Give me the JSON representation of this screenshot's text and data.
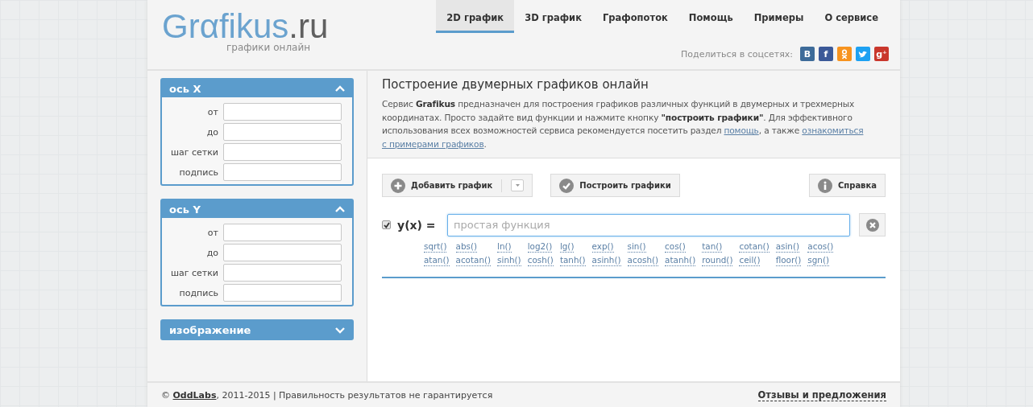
{
  "logo": {
    "name": "Grαfikus",
    "domain": ".ru",
    "tagline": "графики онлайн"
  },
  "nav": [
    {
      "label": "2D график",
      "selected": true
    },
    {
      "label": "3D график",
      "selected": false
    },
    {
      "label": "Графопоток",
      "selected": false
    },
    {
      "label": "Помощь",
      "selected": false
    },
    {
      "label": "Примеры",
      "selected": false
    },
    {
      "label": "О сервисе",
      "selected": false
    }
  ],
  "share": {
    "label": "Поделиться в соцсетях:",
    "buttons": [
      {
        "kind": "letter",
        "label": "B",
        "color": "#3d6b99"
      },
      {
        "kind": "letter",
        "label": "f",
        "color": "#3b5998"
      },
      {
        "kind": "ok",
        "color": "#f7931e"
      },
      {
        "kind": "bird",
        "color": "#1da1f2"
      },
      {
        "kind": "letter",
        "label": "g⁺",
        "color": "#c9372c"
      }
    ]
  },
  "sidebar": {
    "panels": [
      {
        "title": "ось X",
        "expanded": true,
        "fields": [
          {
            "label": "от"
          },
          {
            "label": "до"
          },
          {
            "label": "шаг сетки"
          },
          {
            "label": "подпись"
          }
        ]
      },
      {
        "title": "ось Y",
        "expanded": true,
        "fields": [
          {
            "label": "от"
          },
          {
            "label": "до"
          },
          {
            "label": "шаг сетки"
          },
          {
            "label": "подпись"
          }
        ]
      },
      {
        "title": "изображение",
        "expanded": false
      }
    ]
  },
  "main": {
    "title": "Построение двумерных графиков онлайн",
    "intro": [
      {
        "kind": "text",
        "text": "Сервис **Grafikus** предназначен для построения графиков различных функций в двумерных и трехмерных координатах. Просто задайте вид функции и нажмите кнопку **\"построить графики\"**. Для эффективного использования всех возможностей сервиса рекомендуется посетить раздел "
      },
      {
        "kind": "link",
        "text": "помощь"
      },
      {
        "kind": "text",
        "text": ", а также "
      },
      {
        "kind": "link",
        "text": "ознакомиться"
      },
      {
        "kind": "link",
        "text": "с примерами графиков"
      },
      {
        "kind": "text",
        "text": "."
      }
    ],
    "toolbar": [
      {
        "kind": "add",
        "label": "Добавить график"
      },
      {
        "kind": "build",
        "label": "Построить графики"
      },
      {
        "kind": "help",
        "label": "Справка"
      }
    ],
    "function_row": {
      "checked": true,
      "label": "y(x) =",
      "placeholder": "простая функция"
    },
    "functions": [
      "sqrt()",
      "abs()",
      "ln()",
      "log2()",
      "lg()",
      "exp()",
      "sin()",
      "cos()",
      "tan()",
      "cotan()",
      "asin()",
      "acos()",
      "atan()",
      "acotan()",
      "sinh()",
      "cosh()",
      "tanh()",
      "asinh()",
      "acosh()",
      "atanh()",
      "round()",
      "ceil()",
      "floor()",
      "sgn()"
    ]
  },
  "footer": {
    "parts": [
      {
        "kind": "text",
        "text": "© "
      },
      {
        "kind": "link",
        "text": "OddLabs"
      },
      {
        "kind": "text",
        "text": ", 2011-2015 | Правильность результатов не гарантируется"
      }
    ],
    "feedback": "Отзывы и предложения"
  }
}
